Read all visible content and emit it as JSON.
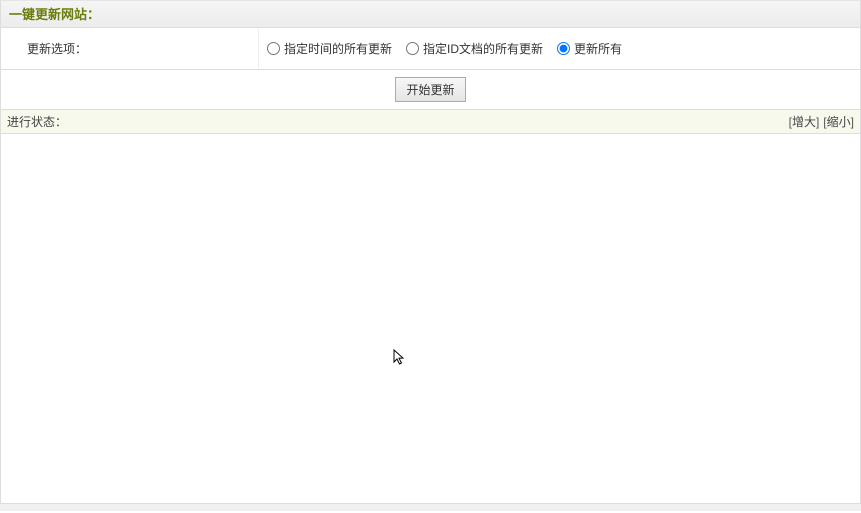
{
  "header": {
    "title": "一键更新网站："
  },
  "options": {
    "label": "更新选项：",
    "radios": [
      {
        "label": "指定时间的所有更新",
        "checked": false
      },
      {
        "label": "指定ID文档的所有更新",
        "checked": false
      },
      {
        "label": "更新所有",
        "checked": true
      }
    ]
  },
  "action": {
    "start_label": "开始更新"
  },
  "status": {
    "label": "进行状态：",
    "expand": "增大",
    "shrink": "缩小",
    "bracket_open": "[",
    "bracket_close": "]"
  }
}
